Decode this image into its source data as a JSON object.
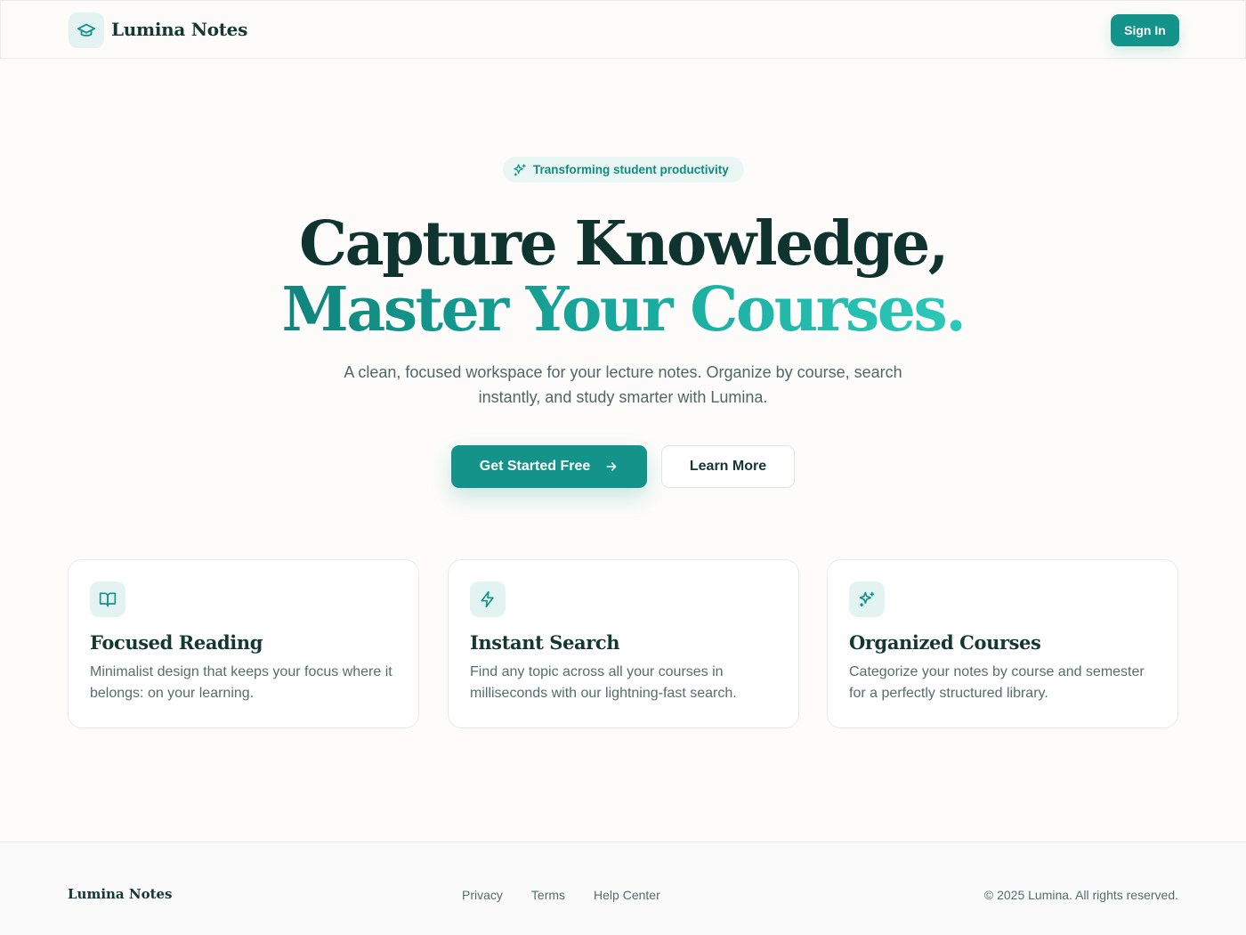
{
  "header": {
    "brand": "Lumina Notes",
    "signin_label": "Sign In",
    "logo_icon": "graduation-cap-icon"
  },
  "hero": {
    "badge": "Transforming student productivity",
    "badge_icon": "sparkles-icon",
    "title_line1": "Capture Knowledge,",
    "title_line2": "Master Your Courses.",
    "subtitle": "A clean, focused workspace for your lecture notes. Organize by course, search instantly, and study smarter with Lumina.",
    "primary_cta": "Get Started Free",
    "secondary_cta": "Learn More"
  },
  "features": [
    {
      "icon": "book-open-icon",
      "title": "Focused Reading",
      "description": "Minimalist design that keeps your focus where it belongs: on your learning."
    },
    {
      "icon": "lightning-icon",
      "title": "Instant Search",
      "description": "Find any topic across all your courses in milliseconds with our lightning-fast search."
    },
    {
      "icon": "sparkles-icon",
      "title": "Organized Courses",
      "description": "Categorize your notes by course and semester for a perfectly structured library."
    }
  ],
  "footer": {
    "brand": "Lumina Notes",
    "links": [
      "Privacy",
      "Terms",
      "Help Center"
    ],
    "copyright": "© 2025 Lumina. All rights reserved."
  },
  "colors": {
    "accent": "#13938a",
    "accent_light": "#e3f3f1",
    "heading": "#0f3430",
    "body_text": "#566e6b",
    "background": "#fdfcfa"
  }
}
